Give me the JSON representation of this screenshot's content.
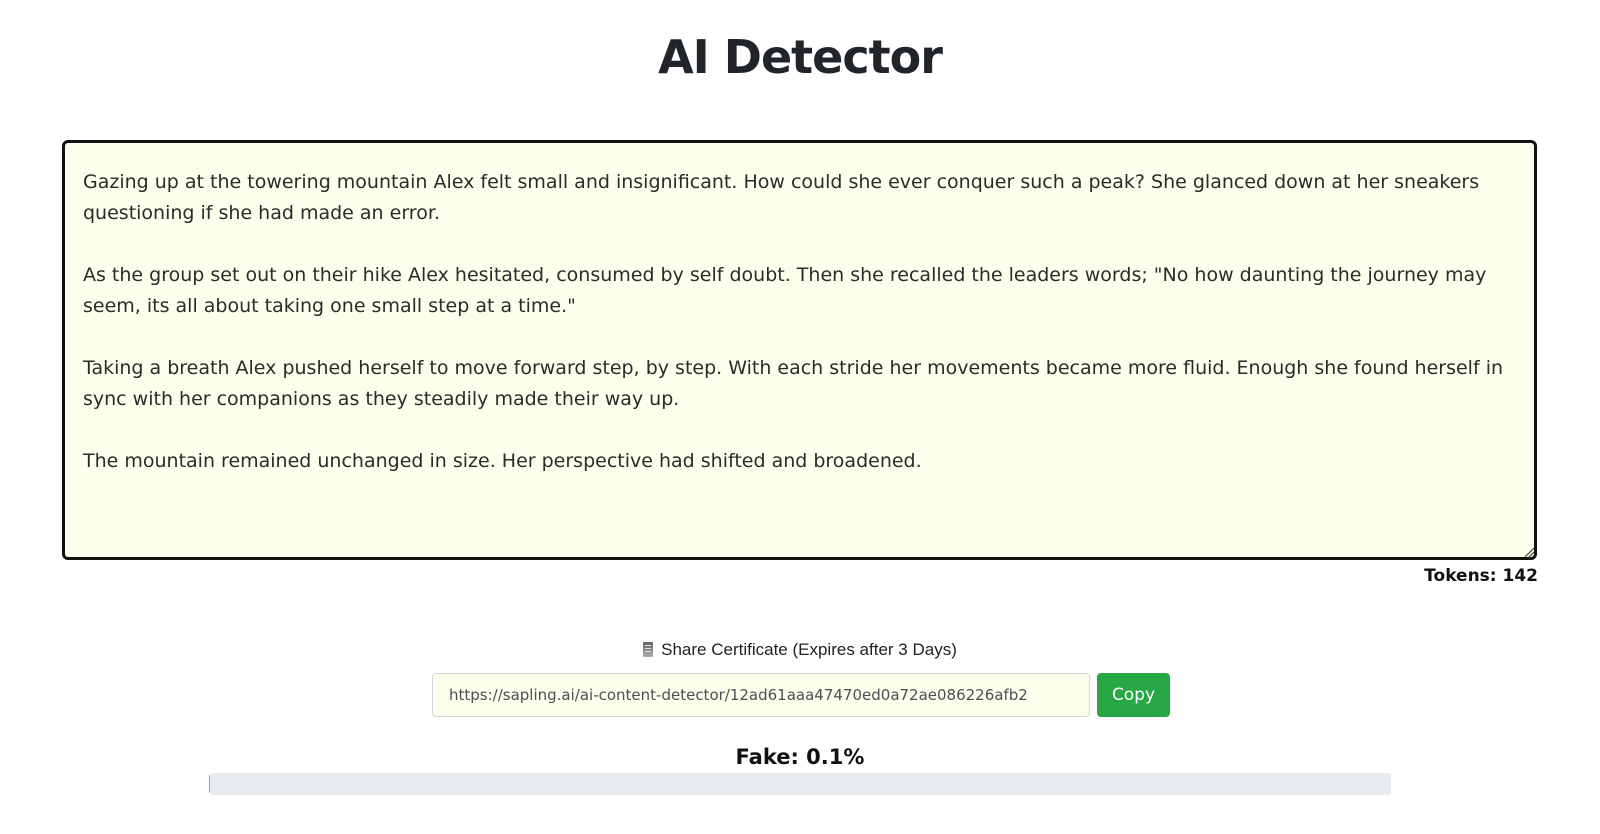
{
  "page": {
    "title": "AI Detector"
  },
  "editor": {
    "text": "Gazing up at the towering mountain Alex felt small and insignificant. How could she ever conquer such a peak? She glanced down at her sneakers questioning if she had made an error.\n\nAs the group set out on their hike Alex hesitated, consumed by self doubt. Then she recalled the leaders words; \"No how daunting the journey may seem, its all about taking one small step at a time.\"\n\nTaking a breath Alex pushed herself to move forward step, by step. With each stride her movements became more fluid. Enough she found herself in sync with her companions as they steadily made their way up.\n\nThe mountain remained unchanged in size. Her perspective had shifted and broadened.",
    "tokens_label": "Tokens: 142"
  },
  "share": {
    "icon": "scroll-icon",
    "label": "Share Certificate (Expires after 3 Days)",
    "url": "https://sapling.ai/ai-content-detector/12ad61aaa47470ed0a72ae086226afb2",
    "copy_label": "Copy"
  },
  "result": {
    "fake_label": "Fake: 0.1%",
    "fake_fraction": 0.001,
    "colors": {
      "track": "#e9ecef",
      "fill": "#c9a227",
      "copy_button": "#28a745"
    }
  }
}
